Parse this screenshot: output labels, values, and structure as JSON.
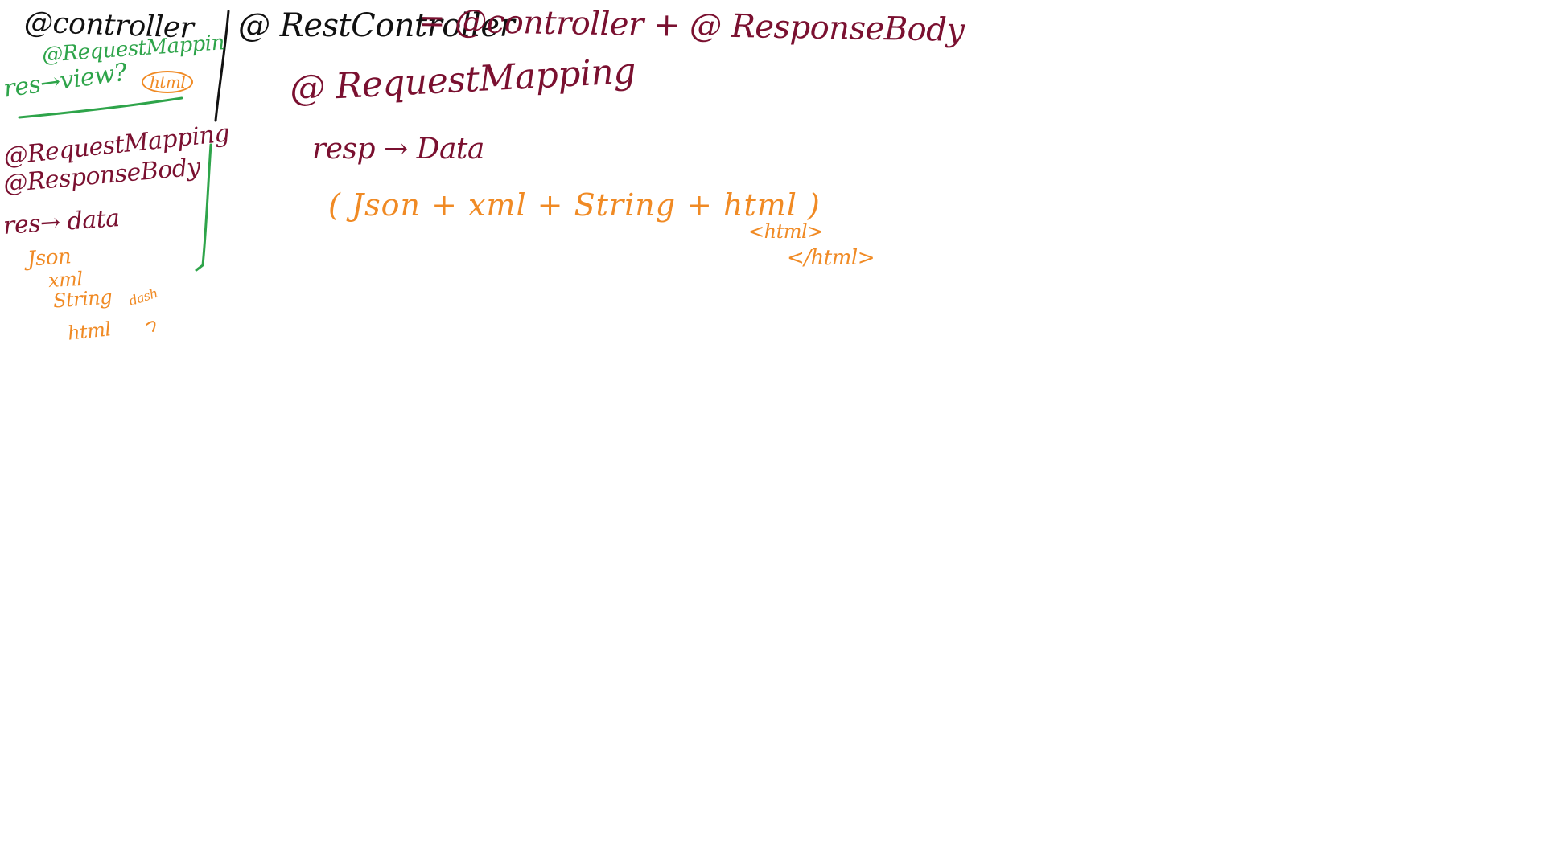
{
  "notes": {
    "controller": "@controller",
    "request_mapping_green": "@RequestMappin",
    "res_view": "res→view?",
    "html_circled": "html",
    "request_mapping_left": "@RequestMapping",
    "response_body_left": "@ResponseBody",
    "res_data_left": "res→ data",
    "type_json": "Json",
    "type_xml": "xml",
    "type_string": "String",
    "type_html": "html",
    "dash_small": "dash",
    "rest_controller": "@ RestController",
    "formula": "= @controller + @ ResponseBody",
    "request_mapping_main": "@ RequestMapping",
    "resp_data": "resp → Data",
    "types_main": "( Json + xml + String + html )",
    "html_open_tag": "<html>",
    "html_close_tag": "</html>"
  },
  "colors": {
    "black": "#111111",
    "maroon": "#7a1030",
    "green": "#2ea44a",
    "orange": "#f08a24"
  }
}
